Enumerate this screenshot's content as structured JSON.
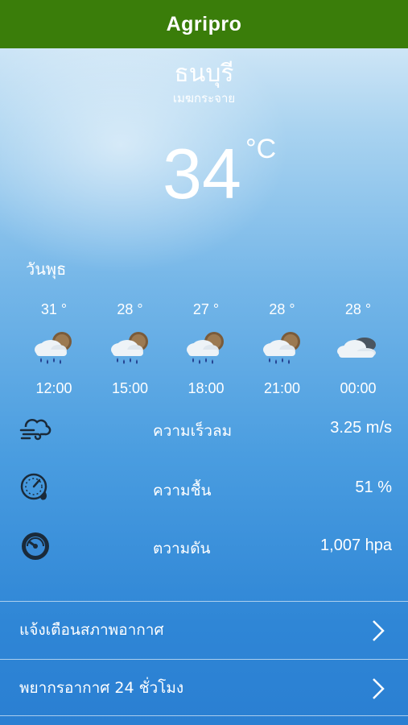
{
  "app": {
    "title": "Agripro"
  },
  "location": {
    "city": "ธนบุรี",
    "condition": "เมฆกระจาย"
  },
  "current": {
    "temp": "34",
    "unit": "°C"
  },
  "day_label": "วันพุธ",
  "hourly": [
    {
      "temp": "31 °",
      "time": "12:00",
      "icon": "rain-cloud-moon-icon"
    },
    {
      "temp": "28 °",
      "time": "15:00",
      "icon": "rain-cloud-moon-icon"
    },
    {
      "temp": "27 °",
      "time": "18:00",
      "icon": "rain-cloud-moon-icon"
    },
    {
      "temp": "28 °",
      "time": "21:00",
      "icon": "rain-cloud-moon-icon"
    },
    {
      "temp": "28 °",
      "time": "00:00",
      "icon": "cloud-icon"
    }
  ],
  "stats": {
    "wind": {
      "label": "ความเร็วลม",
      "value": "3.25 m/s",
      "icon": "wind-cloud-icon"
    },
    "humidity": {
      "label": "ความชื้น",
      "value": "51 %",
      "icon": "humidity-gauge-icon"
    },
    "pressure": {
      "label": "ตวามดัน",
      "value": "1,007 hpa",
      "icon": "pressure-gauge-icon"
    }
  },
  "menu": {
    "alerts": {
      "label": "แจ้งเตือนสภาพอากาศ"
    },
    "forecast24": {
      "label": "พยากรอากาศ 24 ชั่วโมง"
    }
  },
  "colors": {
    "header": "#3a7d0a",
    "sky_top": "#cde5f6",
    "sky_bottom": "#2a7fd2"
  }
}
